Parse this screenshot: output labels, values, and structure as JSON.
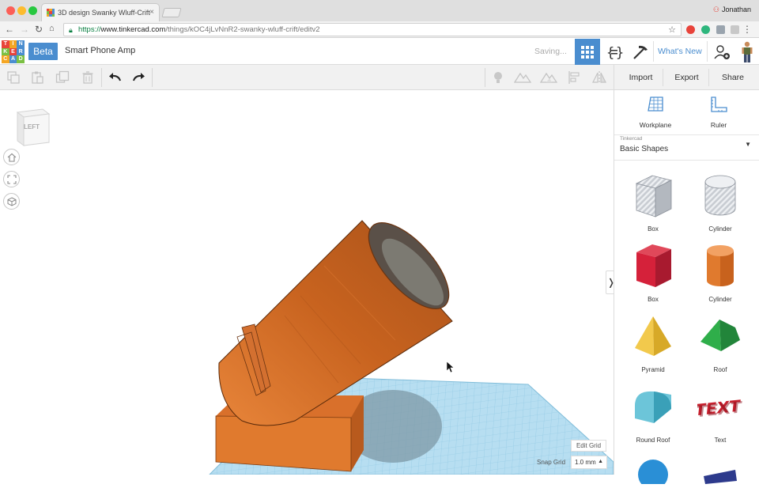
{
  "browser": {
    "tab_title": "3D design Swanky Wluff-Crift",
    "user_name": "Jonathan",
    "url_scheme": "https://",
    "url_domain": "www.tinkercad.com",
    "url_path": "/things/kOC4jLvNnR2-swanky-wluff-crift/editv2"
  },
  "app": {
    "logo_letters": [
      "T",
      "I",
      "N",
      "K",
      "E",
      "R",
      "C",
      "A",
      "D"
    ],
    "beta_label": "Beta",
    "design_name": "Smart Phone Amp",
    "status": "Saving...",
    "whats_new": "What's New"
  },
  "toolbar": {
    "import_label": "Import",
    "export_label": "Export",
    "share_label": "Share"
  },
  "viewport": {
    "view_cube_label": "LEFT",
    "edit_grid_label": "Edit Grid",
    "snap_grid_label": "Snap Grid",
    "snap_grid_value": "1.0 mm"
  },
  "panel": {
    "workplane_label": "Workplane",
    "ruler_label": "Ruler",
    "library_owner": "Tinkercad",
    "library_name": "Basic Shapes",
    "shapes": [
      {
        "label": "Box"
      },
      {
        "label": "Cylinder"
      },
      {
        "label": "Box"
      },
      {
        "label": "Cylinder"
      },
      {
        "label": "Pyramid"
      },
      {
        "label": "Roof"
      },
      {
        "label": "Round Roof"
      },
      {
        "label": "Text"
      }
    ]
  },
  "colors": {
    "accent": "#4a8dcf",
    "object_orange": "#e07a2e",
    "workplane_blue": "#a9d8ee"
  }
}
